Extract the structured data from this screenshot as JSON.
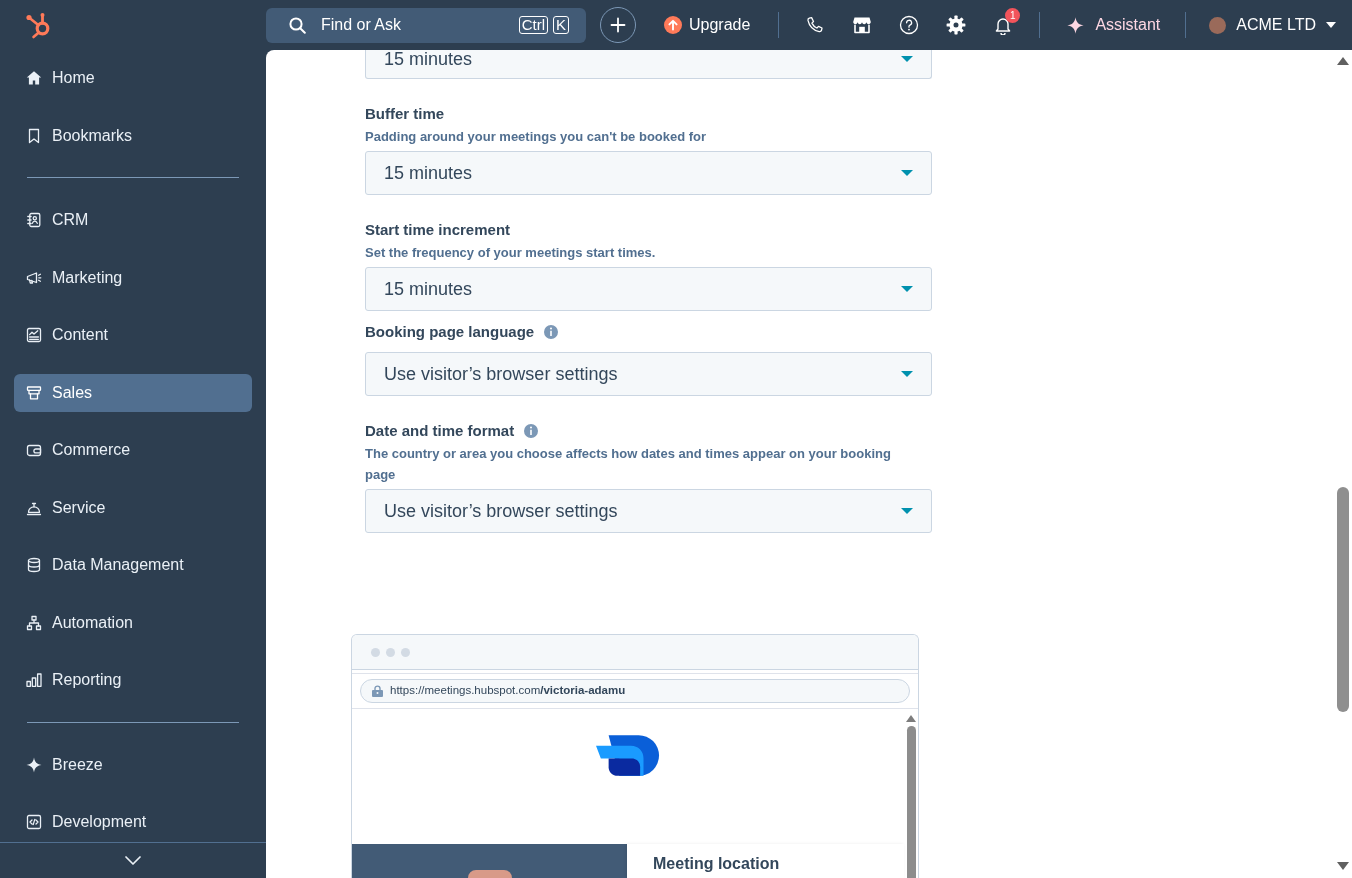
{
  "topbar": {
    "search": {
      "placeholder": "Find or Ask",
      "keys": [
        "Ctrl",
        "K"
      ]
    },
    "upgrade": "Upgrade",
    "notification_count": "1",
    "assistant": "Assistant",
    "account": "ACME LTD"
  },
  "sidebar": {
    "groups": [
      {
        "items": [
          {
            "label": "Home",
            "selected": false
          },
          {
            "label": "Bookmarks",
            "selected": false
          }
        ]
      },
      {
        "items": [
          {
            "label": "CRM",
            "selected": false
          },
          {
            "label": "Marketing",
            "selected": false
          },
          {
            "label": "Content",
            "selected": false
          },
          {
            "label": "Sales",
            "selected": true
          },
          {
            "label": "Commerce",
            "selected": false
          },
          {
            "label": "Service",
            "selected": false
          },
          {
            "label": "Data Management",
            "selected": false
          },
          {
            "label": "Automation",
            "selected": false
          },
          {
            "label": "Reporting",
            "selected": false
          }
        ]
      },
      {
        "items": [
          {
            "label": "Breeze",
            "selected": false
          },
          {
            "label": "Development",
            "selected": false
          }
        ]
      }
    ]
  },
  "form": {
    "fields": [
      {
        "value": "15 minutes"
      },
      {
        "label": "Buffer time",
        "help": "Padding around your meetings you can't be booked for",
        "value": "15 minutes"
      },
      {
        "label": "Start time increment",
        "help": "Set the frequency of your meetings start times.",
        "value": "15 minutes"
      },
      {
        "label": "Booking page language",
        "info": true,
        "value": "Use visitor’s browser settings"
      },
      {
        "label": "Date and time format",
        "info": true,
        "help": "The country or area you choose affects how dates and times appear on your booking page",
        "value": "Use visitor’s browser settings"
      }
    ]
  },
  "preview": {
    "url": "https://meetings.hubspot.com**/victoria-adamu**",
    "heading": "Meeting location"
  }
}
